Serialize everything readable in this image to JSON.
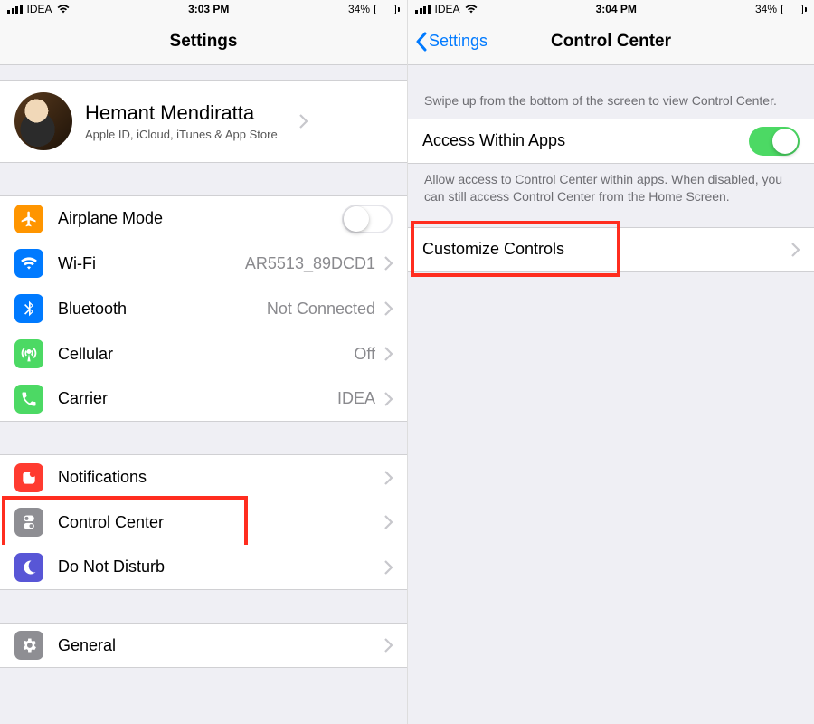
{
  "left": {
    "status": {
      "carrier": "IDEA",
      "time": "3:03 PM",
      "battery_pct": "34%"
    },
    "nav": {
      "title": "Settings"
    },
    "profile": {
      "name": "Hemant Mendiratta",
      "subtitle": "Apple ID, iCloud, iTunes & App Store"
    },
    "rows": {
      "airplane": "Airplane Mode",
      "wifi": "Wi-Fi",
      "wifi_value": "AR5513_89DCD1",
      "bluetooth": "Bluetooth",
      "bluetooth_value": "Not Connected",
      "cellular": "Cellular",
      "cellular_value": "Off",
      "carrier": "Carrier",
      "carrier_value": "IDEA",
      "notifications": "Notifications",
      "control_center": "Control Center",
      "dnd": "Do Not Disturb",
      "general": "General"
    }
  },
  "right": {
    "status": {
      "carrier": "IDEA",
      "time": "3:04 PM",
      "battery_pct": "34%"
    },
    "nav": {
      "back": "Settings",
      "title": "Control Center"
    },
    "intro": "Swipe up from the bottom of the screen to view Control Center.",
    "access_label": "Access Within Apps",
    "access_footer": "Allow access to Control Center within apps. When disabled, you can still access Control Center from the Home Screen.",
    "customize": "Customize Controls"
  }
}
